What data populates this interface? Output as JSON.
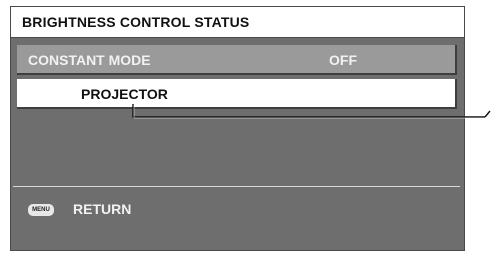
{
  "menu": {
    "title": "BRIGHTNESS CONTROL STATUS",
    "rows": [
      {
        "label": "CONSTANT MODE",
        "value": "OFF"
      },
      {
        "label": "PROJECTOR"
      }
    ],
    "footer": {
      "key_label": "MENU",
      "action_label": "RETURN"
    }
  },
  "colors": {
    "panel_background": "#6e6e6e",
    "header_background": "#ffffff",
    "disabled_row_background": "#9a9a9a",
    "selected_row_background": "#ffffff",
    "text_light": "#f2f2f2",
    "text_dark": "#111111"
  }
}
